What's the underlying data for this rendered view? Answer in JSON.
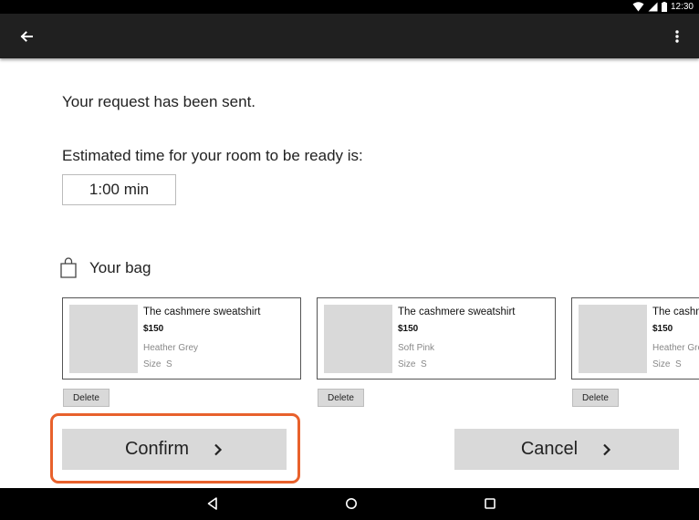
{
  "status_bar": {
    "time": "12:30",
    "icons": [
      "wifi-icon",
      "signal-icon",
      "battery-icon"
    ]
  },
  "app_bar": {
    "back_icon": "arrow-back-icon",
    "menu_icon": "more-vert-icon",
    "background": "#202020"
  },
  "main": {
    "sent_message": "Your request has been sent.",
    "eta_label": "Estimated time for your room to be ready is:",
    "eta_value": "1:00 min"
  },
  "bag": {
    "icon": "shopping-bag-icon",
    "title": "Your bag",
    "items": [
      {
        "title": "The cashmere sweatshirt",
        "price": "$150",
        "color": "Heather Grey",
        "size_label": "Size",
        "size": "S",
        "delete_label": "Delete"
      },
      {
        "title": "The cashmere sweatshirt",
        "price": "$150",
        "color": "Soft Pink",
        "size_label": "Size",
        "size": "S",
        "delete_label": "Delete"
      },
      {
        "title": "The cashmere sweatshirt",
        "price": "$150",
        "color": "Heather Grey",
        "size_label": "Size",
        "size": "S",
        "delete_label": "Delete"
      }
    ]
  },
  "actions": {
    "confirm_label": "Confirm",
    "cancel_label": "Cancel",
    "chevron_icon": "chevron-right-icon",
    "highlight_color": "#e8612c"
  },
  "nav_bar": {
    "icons": [
      "nav-back-icon",
      "nav-home-icon",
      "nav-recents-icon"
    ]
  }
}
